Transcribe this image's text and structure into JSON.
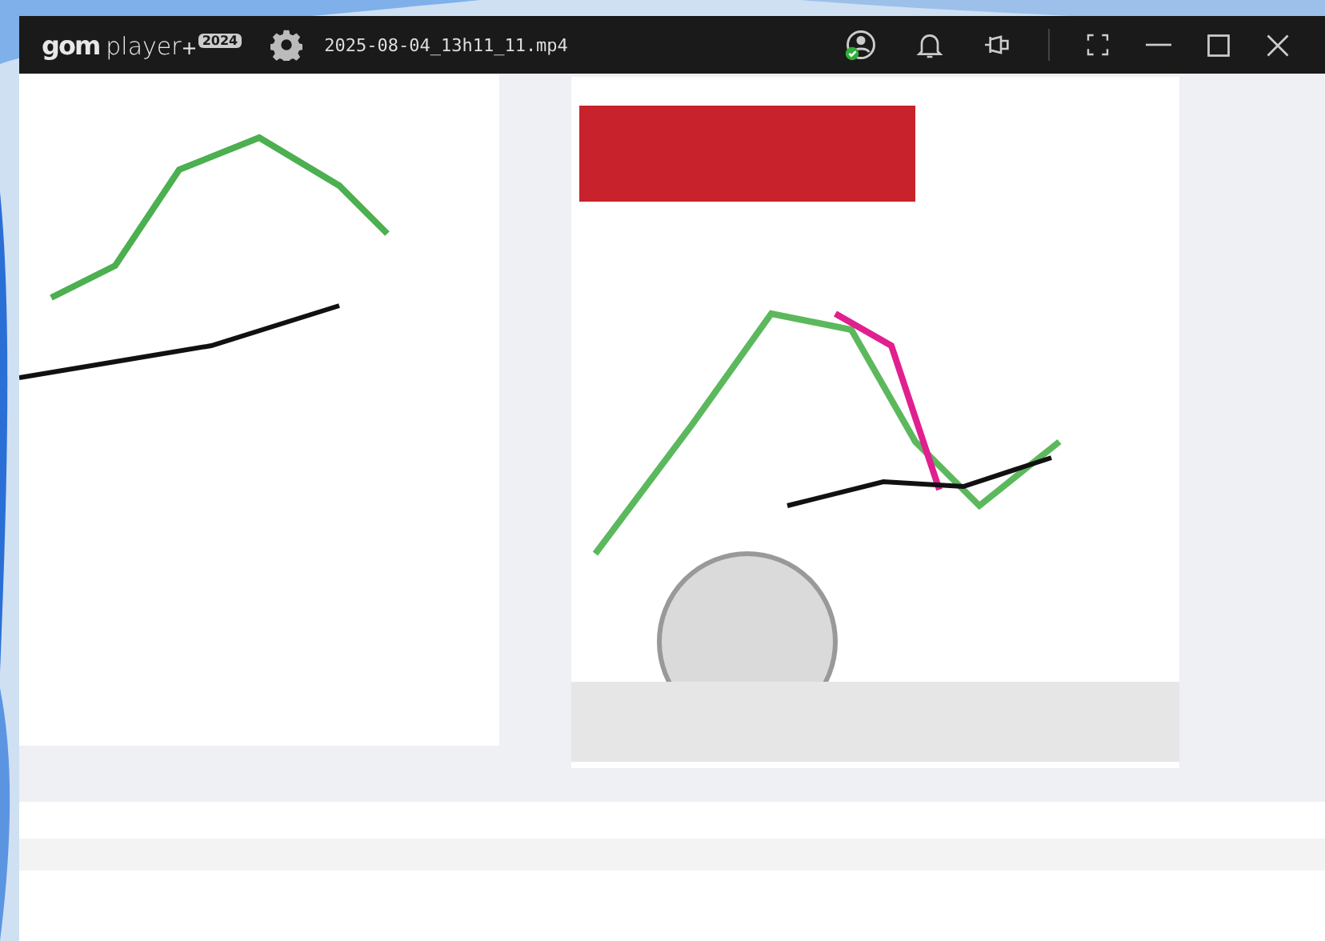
{
  "player": {
    "logo": {
      "brand": "gom",
      "product": "player",
      "plus": "+",
      "badge": "2024"
    },
    "file_name": "2025-08-04_13h11_11.mp4"
  }
}
